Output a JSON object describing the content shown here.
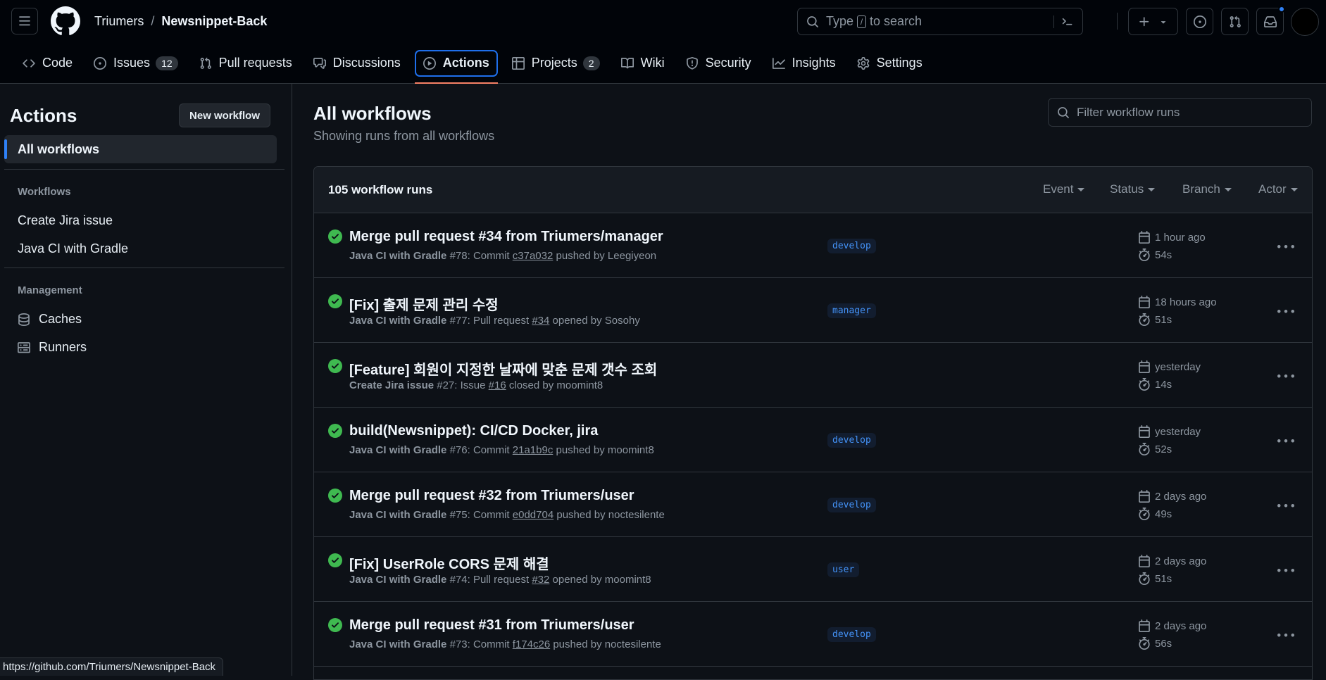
{
  "header": {
    "owner": "Triumers",
    "separator": "/",
    "repo": "Newsnippet-Back",
    "search_prefix": "Type",
    "search_key": "/",
    "search_suffix": "to search"
  },
  "tabs": [
    {
      "label": "Code",
      "icon": "code-icon"
    },
    {
      "label": "Issues",
      "icon": "issue-icon",
      "count": "12"
    },
    {
      "label": "Pull requests",
      "icon": "pull-request-icon"
    },
    {
      "label": "Discussions",
      "icon": "discussion-icon"
    },
    {
      "label": "Actions",
      "icon": "play-icon",
      "active": true
    },
    {
      "label": "Projects",
      "icon": "table-icon",
      "count": "2"
    },
    {
      "label": "Wiki",
      "icon": "book-icon"
    },
    {
      "label": "Security",
      "icon": "shield-icon"
    },
    {
      "label": "Insights",
      "icon": "graph-icon"
    },
    {
      "label": "Settings",
      "icon": "gear-icon"
    }
  ],
  "sidebar": {
    "title": "Actions",
    "new_workflow": "New workflow",
    "all_workflows": "All workflows",
    "workflows_heading": "Workflows",
    "workflows": [
      "Create Jira issue",
      "Java CI with Gradle"
    ],
    "management_heading": "Management",
    "management": [
      {
        "label": "Caches",
        "icon": "database-icon"
      },
      {
        "label": "Runners",
        "icon": "server-icon"
      }
    ]
  },
  "main": {
    "title": "All workflows",
    "subtitle": "Showing runs from all workflows",
    "filter_placeholder": "Filter workflow runs",
    "runs_count": "105 workflow runs",
    "filters": [
      "Event",
      "Status",
      "Branch",
      "Actor"
    ]
  },
  "runs": [
    {
      "title": "Merge pull request #34 from Triumers/manager",
      "workflow": "Java CI with Gradle",
      "number": "#78",
      "kind": "Commit",
      "ref": "c37a032",
      "action": "pushed by",
      "actor": "Leegiyeon",
      "branch": "develop",
      "when": "1 hour ago",
      "duration": "54s"
    },
    {
      "title": "[Fix] 출제 문제 관리 수정",
      "workflow": "Java CI with Gradle",
      "number": "#77",
      "kind": "Pull request",
      "ref": "#34",
      "action": "opened by",
      "actor": "Sosohy",
      "branch": "manager",
      "when": "18 hours ago",
      "duration": "51s"
    },
    {
      "title": "[Feature] 회원이 지정한 날짜에 맞춘 문제 갯수 조회",
      "workflow": "Create Jira issue",
      "number": "#27",
      "kind": "Issue",
      "ref": "#16",
      "action": "closed by",
      "actor": "moomint8",
      "branch": "",
      "when": "yesterday",
      "duration": "14s"
    },
    {
      "title": "build(Newsnippet): CI/CD Docker, jira",
      "workflow": "Java CI with Gradle",
      "number": "#76",
      "kind": "Commit",
      "ref": "21a1b9c",
      "action": "pushed by",
      "actor": "moomint8",
      "branch": "develop",
      "when": "yesterday",
      "duration": "52s"
    },
    {
      "title": "Merge pull request #32 from Triumers/user",
      "workflow": "Java CI with Gradle",
      "number": "#75",
      "kind": "Commit",
      "ref": "e0dd704",
      "action": "pushed by",
      "actor": "noctesilente",
      "branch": "develop",
      "when": "2 days ago",
      "duration": "49s"
    },
    {
      "title": "[Fix] UserRole CORS 문제 해결",
      "workflow": "Java CI with Gradle",
      "number": "#74",
      "kind": "Pull request",
      "ref": "#32",
      "action": "opened by",
      "actor": "moomint8",
      "branch": "user",
      "when": "2 days ago",
      "duration": "51s"
    },
    {
      "title": "Merge pull request #31 from Triumers/user",
      "workflow": "Java CI with Gradle",
      "number": "#73",
      "kind": "Commit",
      "ref": "f174c26",
      "action": "pushed by",
      "actor": "noctesilente",
      "branch": "develop",
      "when": "2 days ago",
      "duration": "56s"
    }
  ],
  "statusbar": {
    "url": "https://github.com/Triumers/Newsnippet-Back"
  },
  "colors": {
    "accent": "#2f81f7",
    "success": "#3fb950",
    "tab_underline": "#f78166"
  }
}
